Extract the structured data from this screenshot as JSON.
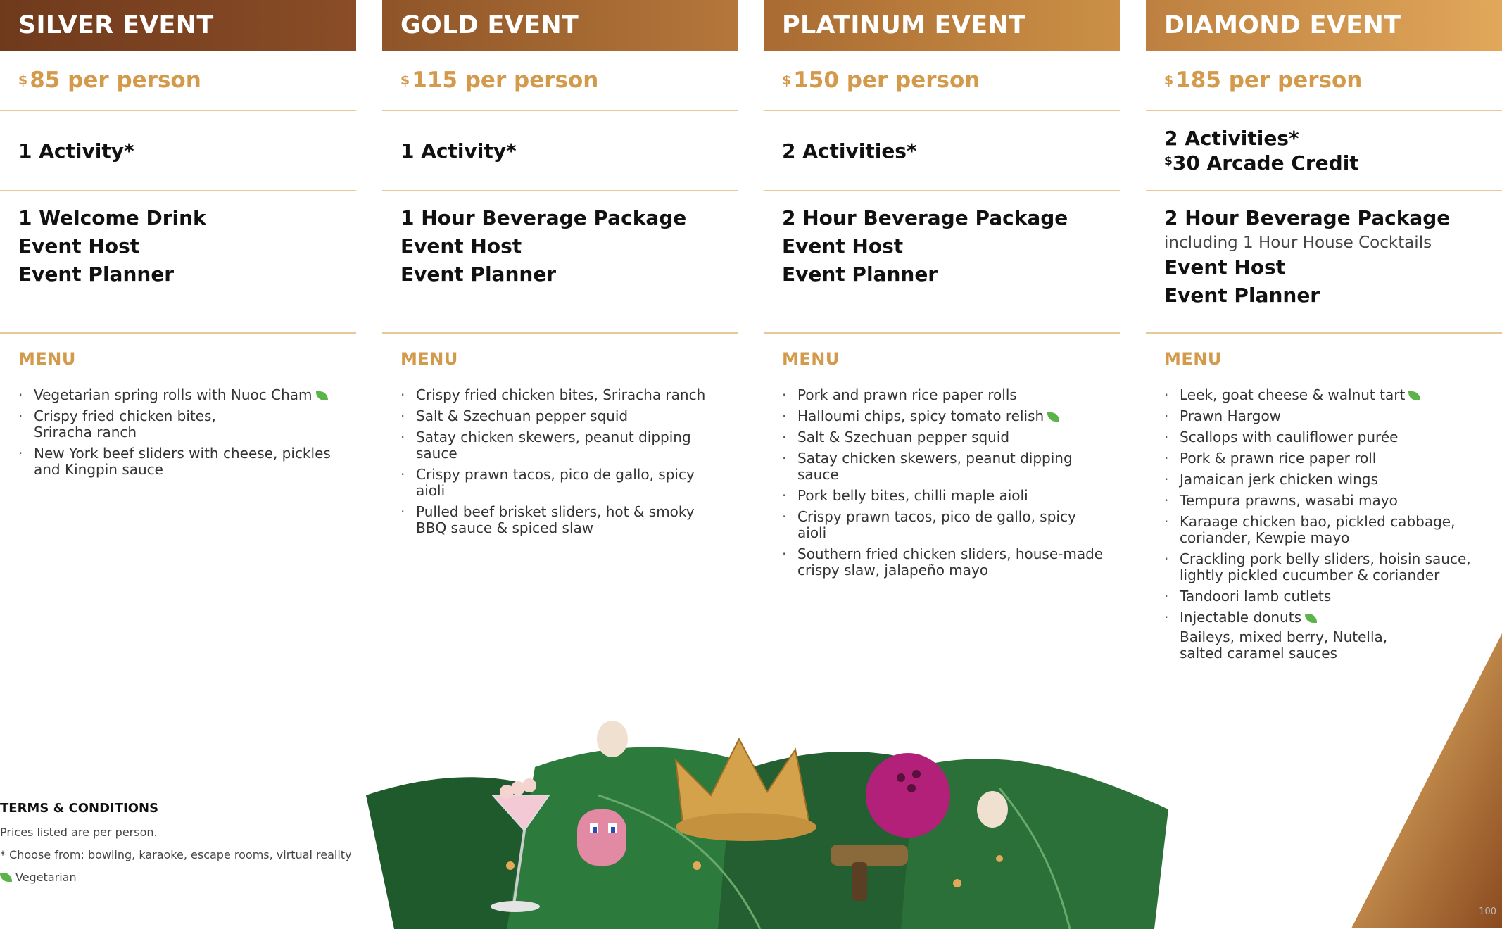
{
  "columns": [
    {
      "title": "SILVER EVENT",
      "price_currency": "$",
      "price": "85 per person",
      "activities": [
        "1 Activity*"
      ],
      "package_lines": [
        {
          "text": "1 Welcome Drink",
          "bold": true
        },
        {
          "text": "Event Host",
          "bold": true
        },
        {
          "text": "Event Planner",
          "bold": true
        }
      ],
      "menu_title": "MENU",
      "menu": [
        {
          "text": "Vegetarian spring rolls with Nuoc Cham",
          "veg": true
        },
        {
          "text": "Crispy fried chicken bites,\nSriracha ranch",
          "veg": false
        },
        {
          "text": "New York beef sliders with cheese, pickles and Kingpin sauce",
          "veg": false
        }
      ]
    },
    {
      "title": "GOLD EVENT",
      "price_currency": "$",
      "price": "115 per person",
      "activities": [
        "1 Activity*"
      ],
      "package_lines": [
        {
          "text": "1 Hour Beverage Package",
          "bold": true
        },
        {
          "text": "Event Host",
          "bold": true
        },
        {
          "text": "Event Planner",
          "bold": true
        }
      ],
      "menu_title": "MENU",
      "menu": [
        {
          "text": "Crispy fried chicken bites, Sriracha ranch",
          "veg": false
        },
        {
          "text": "Salt & Szechuan pepper squid",
          "veg": false
        },
        {
          "text": "Satay chicken skewers, peanut dipping sauce",
          "veg": false
        },
        {
          "text": "Crispy prawn tacos, pico de gallo, spicy aioli",
          "veg": false
        },
        {
          "text": "Pulled beef brisket sliders, hot & smoky BBQ sauce & spiced slaw",
          "veg": false
        }
      ]
    },
    {
      "title": "PLATINUM EVENT",
      "price_currency": "$",
      "price": "150 per person",
      "activities": [
        "2 Activities*"
      ],
      "package_lines": [
        {
          "text": "2 Hour Beverage Package",
          "bold": true
        },
        {
          "text": "Event Host",
          "bold": true
        },
        {
          "text": "Event Planner",
          "bold": true
        }
      ],
      "menu_title": "MENU",
      "menu": [
        {
          "text": "Pork and prawn rice paper rolls",
          "veg": false
        },
        {
          "text": "Halloumi chips, spicy tomato relish",
          "veg": true
        },
        {
          "text": "Salt & Szechuan pepper squid",
          "veg": false
        },
        {
          "text": "Satay chicken skewers, peanut dipping sauce",
          "veg": false
        },
        {
          "text": "Pork belly bites, chilli maple aioli",
          "veg": false
        },
        {
          "text": "Crispy prawn tacos, pico de gallo, spicy aioli",
          "veg": false
        },
        {
          "text": "Southern fried chicken sliders, house-made crispy slaw, jalapeño mayo",
          "veg": false
        }
      ]
    },
    {
      "title": "DIAMOND EVENT",
      "price_currency": "$",
      "price": "185 per person",
      "activities": [
        "2 Activities*"
      ],
      "activity_extra_currency": "$",
      "activity_extra": "30 Arcade Credit",
      "package_lines": [
        {
          "text": "2 Hour Beverage Package",
          "bold": true
        },
        {
          "text": "including 1 Hour House Cocktails",
          "bold": false
        },
        {
          "text": "Event Host",
          "bold": true
        },
        {
          "text": "Event Planner",
          "bold": true
        }
      ],
      "menu_title": "MENU",
      "menu": [
        {
          "text": "Leek, goat cheese & walnut tart",
          "veg": true
        },
        {
          "text": "Prawn Hargow",
          "veg": false
        },
        {
          "text": "Scallops with cauliflower purée",
          "veg": false
        },
        {
          "text": "Pork & prawn rice paper roll",
          "veg": false
        },
        {
          "text": "Jamaican jerk chicken wings",
          "veg": false
        },
        {
          "text": "Tempura prawns, wasabi mayo",
          "veg": false
        },
        {
          "text": "Karaage chicken bao, pickled cabbage, coriander, Kewpie mayo",
          "veg": false
        },
        {
          "text": "Crackling pork belly sliders, hoisin sauce, lightly pickled cucumber & coriander",
          "veg": false
        },
        {
          "text": "Tandoori lamb cutlets",
          "veg": false
        },
        {
          "text": "Injectable donuts",
          "veg": true
        }
      ],
      "menu_note": "Baileys, mixed berry, Nutella, salted caramel sauces"
    }
  ],
  "terms": {
    "title": "TERMS & CONDITIONS",
    "lines": [
      "Prices listed are per person.",
      "* Choose from: bowling, karaoke, escape rooms, virtual reality"
    ],
    "veg_legend": "Vegetarian"
  },
  "page_number": "100",
  "colors": {
    "gold_text": "#d49a4c",
    "rule": "#e7c89a",
    "veg_leaf": "#5bb34a"
  }
}
